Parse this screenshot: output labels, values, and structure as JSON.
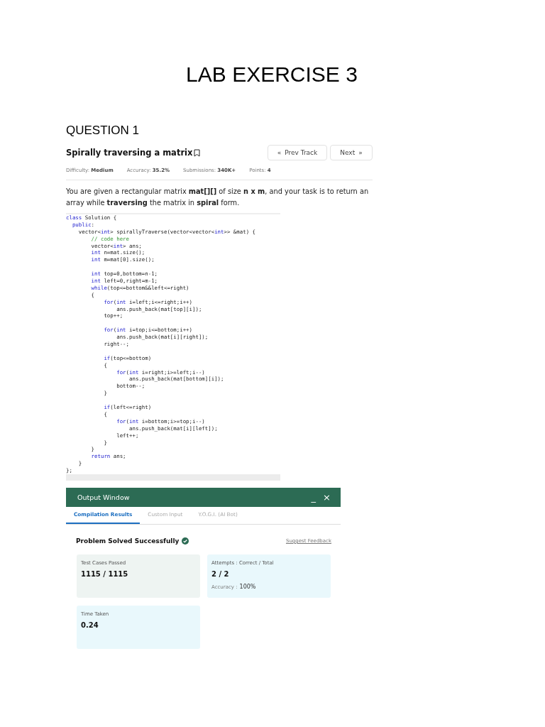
{
  "page": {
    "title": "LAB EXERCISE 3",
    "section": "QUESTION 1"
  },
  "problem": {
    "title": "Spirally traversing a matrix",
    "buttons": [
      {
        "kind": "prev",
        "label": "Prev Track",
        "icon": "«"
      },
      {
        "kind": "next",
        "label": "Next",
        "icon": "»"
      }
    ],
    "meta": [
      "Difficulty: **Medium**",
      "Accuracy: **35.2%**",
      "Submissions: **340K+**",
      "Points: **4**"
    ],
    "description": "You are given a rectangular matrix **mat[][]** of size **n x m**, and your task is to return an array while **traversing** the matrix in **spiral** form."
  },
  "code_blocks": [
    [
      "class Solution {",
      "  public:",
      "    vector<int> spirallyTraverse(vector<vector<int>> &mat) {",
      "        // code here",
      "        vector<int> ans;",
      "        int n=mat.size();",
      "        int m=mat[0].size();"
    ],
    [
      "        int top=0,bottom=n-1;",
      "        int left=0,right=m-1;",
      "        while(top<=bottom&&left<=right)",
      "        {",
      "            for(int i=left;i<=right;i++)",
      "                ans.push_back(mat[top][i]);",
      "            top++;"
    ],
    [
      "            for(int i=top;i<=bottom;i++)",
      "                ans.push_back(mat[i][right]);",
      "            right--;"
    ],
    [
      "            if(top<=bottom)",
      "            {",
      "                for(int i=right;i>=left;i--)",
      "                    ans.push_back(mat[bottom][i]);",
      "                bottom--;",
      "            }"
    ],
    [
      "            if(left<=right)",
      "            {",
      "                for(int i=bottom;i>=top;i--)",
      "                    ans.push_back(mat[i][left]);",
      "                left++;",
      "            }",
      "        }",
      "        return ans;",
      "    }",
      "};"
    ]
  ],
  "output": {
    "title": "Output Window",
    "minimize": "_",
    "close": "×",
    "tabs": [
      {
        "label": "Compilation Results",
        "selected": true
      },
      {
        "label": "Custom Input",
        "selected": false
      },
      {
        "label": "Y.O.G.I. (AI Bot)",
        "selected": false
      }
    ],
    "status": "Problem Solved Successfully",
    "feedback": "Suggest Feedback",
    "cards": [
      {
        "label": "Test Cases Passed",
        "value": "1115 / 1115",
        "color": "#eef4f2"
      },
      {
        "label": "Attempts : Correct / Total",
        "value": "2 / 2",
        "note_label": "Accuracy :",
        "note_value": "100%",
        "color": "#e9f8fc"
      },
      {
        "label": "Time Taken",
        "value": "0.24",
        "color": "#e9f8fc"
      }
    ]
  }
}
